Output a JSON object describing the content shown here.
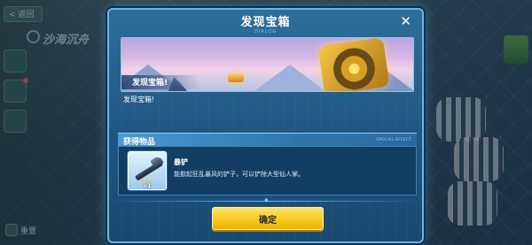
{
  "background": {
    "back_label": "< 返回",
    "area_title": "沙海沉舟",
    "reset_label": "重置"
  },
  "dialog": {
    "title": "发现宝箱",
    "subtitle": "DIALOG",
    "close_icon": "close-icon",
    "banner_label": "发现宝箱!",
    "message": "发现宝箱!"
  },
  "items_section": {
    "title": "获得物品",
    "subtitle": "SPECIAL EFFECT",
    "items": [
      {
        "name": "暴铲",
        "description": "能掀起狂乱暴风的铲子，可以铲除大型仙人掌。",
        "stars": "★★★",
        "quantity": "×1",
        "icon": "shovel-icon"
      }
    ]
  },
  "confirm_label": "确定",
  "colors": {
    "dialog_bg": "#1f5580",
    "dialog_border": "#69b4ea",
    "header_bar": "#3a88c2",
    "confirm_button": "#f7c81a",
    "item_card": "#123e63"
  }
}
